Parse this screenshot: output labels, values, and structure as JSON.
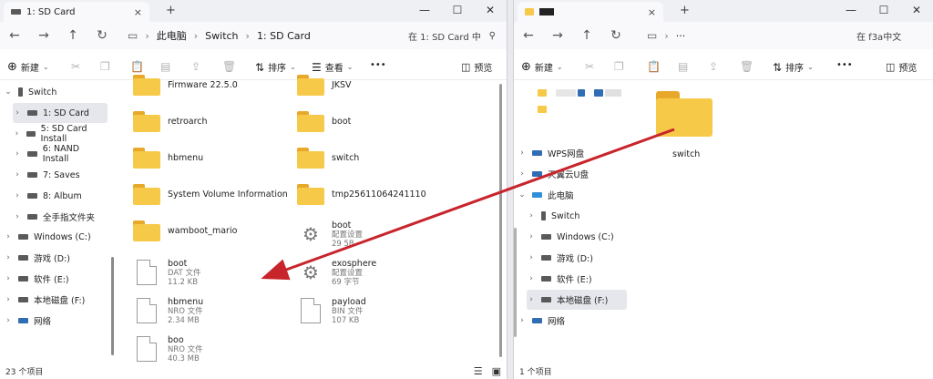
{
  "left_window": {
    "tab_title": "1: SD Card",
    "tab_close": "×",
    "tab_add": "+",
    "controls": {
      "minimize": "—",
      "maximize": "☐",
      "close": "✕"
    },
    "nav": {
      "back": "←",
      "forward": "→",
      "up": "↑",
      "refresh": "↻"
    },
    "address": [
      "此电脑",
      "Switch",
      "1: SD Card"
    ],
    "address_sep": "›",
    "search_placeholder": "在 1: SD Card 中",
    "toolbar": {
      "new": "新建",
      "sort": "排序",
      "view": "查看",
      "more": "•••",
      "preview": "预览"
    },
    "sidebar": [
      {
        "label": "Switch",
        "level": 0,
        "expanded": true
      },
      {
        "label": "1: SD Card",
        "level": 1,
        "selected": true
      },
      {
        "label": "5: SD Card Install",
        "level": 1
      },
      {
        "label": "6: NAND Install",
        "level": 1
      },
      {
        "label": "7: Saves",
        "level": 1
      },
      {
        "label": "8: Album",
        "level": 1
      },
      {
        "label": "全手指文件夹",
        "level": 1
      },
      {
        "label": "Windows (C:)",
        "level": 0
      },
      {
        "label": "游戏 (D:)",
        "level": 0
      },
      {
        "label": "软件 (E:)",
        "level": 0
      },
      {
        "label": "本地磁盘 (F:)",
        "level": 0
      },
      {
        "label": "网络",
        "level": -1
      }
    ],
    "files_col1": [
      {
        "name": "Firmware 22.5.0",
        "kind": "folder"
      },
      {
        "name": "retroarch",
        "kind": "folder"
      },
      {
        "name": "hbmenu",
        "kind": "folder"
      },
      {
        "name": "System Volume Information",
        "kind": "folder"
      },
      {
        "name": "wamboot_mario",
        "kind": "folder"
      },
      {
        "name": "boot",
        "kind": "doc",
        "type": "DAT 文件",
        "size": "11.2 KB"
      },
      {
        "name": "hbmenu",
        "kind": "doc",
        "type": "NRO 文件",
        "size": "2.34 MB"
      },
      {
        "name": "boo",
        "kind": "doc",
        "type": "NRO 文件",
        "size": "40.3 MB"
      }
    ],
    "files_col2": [
      {
        "name": "JKSV",
        "kind": "folder"
      },
      {
        "name": "boot",
        "kind": "folder"
      },
      {
        "name": "switch",
        "kind": "folder"
      },
      {
        "name": "tmp25611064241110",
        "kind": "folder"
      },
      {
        "name": "boot",
        "kind": "gear",
        "type": "配置设置",
        "size": "29 5B"
      },
      {
        "name": "exosphere",
        "kind": "gear",
        "type": "配置设置",
        "size": "69 字节"
      },
      {
        "name": "payload",
        "kind": "doc",
        "type": "BIN 文件",
        "size": "107 KB"
      }
    ],
    "status": "23 个项目"
  },
  "right_window": {
    "tab_title": "",
    "tab_close": "×",
    "tab_add": "+",
    "controls": {
      "minimize": "—",
      "maximize": "☐",
      "close": "✕"
    },
    "nav": {
      "back": "←",
      "forward": "→",
      "up": "↑",
      "refresh": "↻"
    },
    "address_more": "···",
    "address_sep": "›",
    "search_placeholder": "在 f3a中文",
    "toolbar": {
      "new": "新建",
      "sort": "排序",
      "more": "•••",
      "preview": "预览"
    },
    "sidebar": [
      {
        "label": "WPS网盘",
        "level": 0
      },
      {
        "label": "天翼云U盘",
        "level": 0
      },
      {
        "label": "此电脑",
        "level": 0,
        "expanded": true
      },
      {
        "label": "Switch",
        "level": 1
      },
      {
        "label": "Windows (C:)",
        "level": 1
      },
      {
        "label": "游戏 (D:)",
        "level": 1
      },
      {
        "label": "软件 (E:)",
        "level": 1
      },
      {
        "label": "本地磁盘 (F:)",
        "level": 1,
        "selected": true
      },
      {
        "label": "网络",
        "level": 0
      }
    ],
    "folder_name": "switch",
    "status": "1 个项目"
  },
  "colors": {
    "folder": "#f7c948",
    "folder_tab": "#e8a92a",
    "arrow": "#c8242b",
    "selected": "#e5e7ec"
  }
}
